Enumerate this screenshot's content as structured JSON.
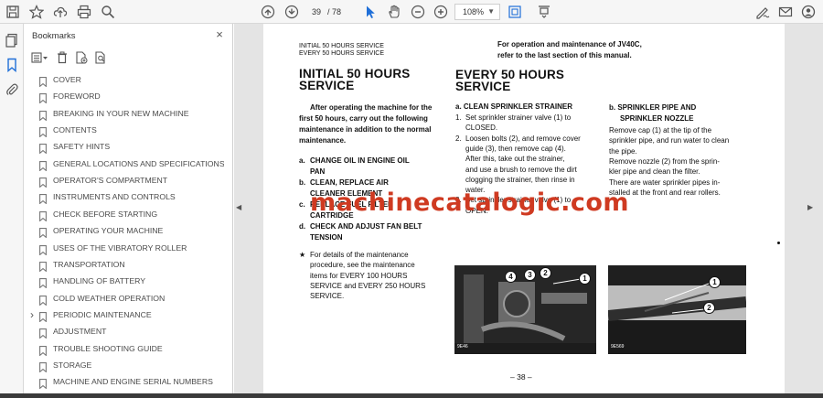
{
  "toolbar": {
    "current_page": "39",
    "total_pages": "/ 78",
    "zoom": "108%",
    "icons": [
      "save-icon",
      "bookmark-star-icon",
      "upload-icon",
      "print-icon",
      "zoom-search-icon",
      "page-up-icon",
      "page-down-icon",
      "select-arrow-icon",
      "hand-icon",
      "zoom-out-icon",
      "zoom-in-icon",
      "fit-page-icon",
      "scroll-mode-icon",
      "sign-icon",
      "email-icon",
      "account-icon"
    ]
  },
  "sidebar": {
    "title": "Bookmarks",
    "close": "×",
    "bookmarks": [
      {
        "label": "COVER",
        "expandable": false
      },
      {
        "label": "FOREWORD",
        "expandable": false
      },
      {
        "label": "BREAKING IN YOUR NEW MACHINE",
        "expandable": false
      },
      {
        "label": "CONTENTS",
        "expandable": false
      },
      {
        "label": "SAFETY HINTS",
        "expandable": false
      },
      {
        "label": "GENERAL LOCATIONS AND SPECIFICATIONS",
        "expandable": false
      },
      {
        "label": "OPERATOR'S COMPARTMENT",
        "expandable": false
      },
      {
        "label": "INSTRUMENTS AND CONTROLS",
        "expandable": false
      },
      {
        "label": "CHECK BEFORE STARTING",
        "expandable": false
      },
      {
        "label": "OPERATING YOUR MACHINE",
        "expandable": false
      },
      {
        "label": "USES OF THE VIBRATORY ROLLER",
        "expandable": false
      },
      {
        "label": "TRANSPORTATION",
        "expandable": false
      },
      {
        "label": "HANDLING OF BATTERY",
        "expandable": false
      },
      {
        "label": "COLD WEATHER OPERATION",
        "expandable": false
      },
      {
        "label": "PERIODIC MAINTENANCE",
        "expandable": true
      },
      {
        "label": "ADJUSTMENT",
        "expandable": false
      },
      {
        "label": "TROUBLE SHOOTING GUIDE",
        "expandable": false
      },
      {
        "label": "STORAGE",
        "expandable": false
      },
      {
        "label": "MACHINE AND ENGINE SERIAL NUMBERS",
        "expandable": false
      }
    ]
  },
  "document": {
    "header_small_1": "INITIAL 50 HOURS SERVICE",
    "header_small_2": "EVERY 50 HOURS SERVICE",
    "header_right_1": "For  operation  and  maintenance  of  JV40C,",
    "header_right_2": "refer to the last section of this manual.",
    "left_heading_1": "INITIAL 50 HOURS",
    "left_heading_2": "SERVICE",
    "left_para": [
      "After operating the machine for the",
      "first 50 hours, carry out the following",
      "maintenance in addition to the normal",
      "maintenance."
    ],
    "left_list": [
      {
        "letter": "a.",
        "lines": [
          "CHANGE OIL IN ENGINE OIL",
          "PAN"
        ]
      },
      {
        "letter": "b.",
        "lines": [
          "CLEAN, REPLACE AIR",
          "CLEANER ELEMENT"
        ]
      },
      {
        "letter": "c.",
        "lines": [
          "REPLACE  FUEL  FILTER",
          "CARTRIDGE"
        ]
      },
      {
        "letter": "d.",
        "lines": [
          "CHECK AND ADJUST FAN BELT",
          "TENSION"
        ]
      }
    ],
    "left_note_star": "★",
    "left_note": [
      "For  details  of  the  maintenance",
      "procedure,  see  the  maintenance",
      "items  for  EVERY  100  HOURS",
      "SERVICE and EVERY 250 HOURS",
      "SERVICE."
    ],
    "mid_heading_1": "EVERY  50  HOURS",
    "mid_heading_2": "SERVICE",
    "mid_sub": "a.  CLEAN SPRINKLER STRAINER",
    "mid_steps": [
      {
        "num": "1.",
        "lines": [
          "Set  sprinkler  strainer  valve  (1)  to",
          "CLOSED."
        ]
      },
      {
        "num": "2.",
        "lines": [
          "Loosen bolts (2), and remove cover",
          "guide  (3),  then  remove  cap  (4).",
          "After  this,  take  out  the  strainer,",
          "and use a brush to remove the dirt",
          "clogging  the  strainer,  then  rinse  in",
          "water."
        ]
      },
      {
        "num": "3.",
        "lines": [
          "Set  sprinkler  strainer  valve  (1)  to",
          "OPEN."
        ]
      }
    ],
    "right_sub_1": "b.  SPRINKLER PIPE AND",
    "right_sub_2": "SPRINKLER NOZZLE",
    "right_para": [
      "Remove cap (1) at the tip of the",
      "sprinkler pipe, and run water to clean",
      "the pipe.",
      "   Remove nozzle (2) from the sprin-",
      "kler pipe and clean the filter.",
      "   There are water sprinkler pipes in-",
      "stalled at the front and rear rollers."
    ],
    "photo1_callouts": [
      "4",
      "3",
      "2",
      "1"
    ],
    "photo1_caption": "9E46",
    "photo2_callouts": [
      "1",
      "2"
    ],
    "photo2_caption": "9E569",
    "page_number": "– 38 –"
  },
  "watermark": "machinecatalogic.com",
  "colors": {
    "watermark": "#cf3a21",
    "toolbar_bg": "#f6f6f6",
    "viewer_bg": "#e4e4e4",
    "select_blue": "#1f6fd8"
  }
}
